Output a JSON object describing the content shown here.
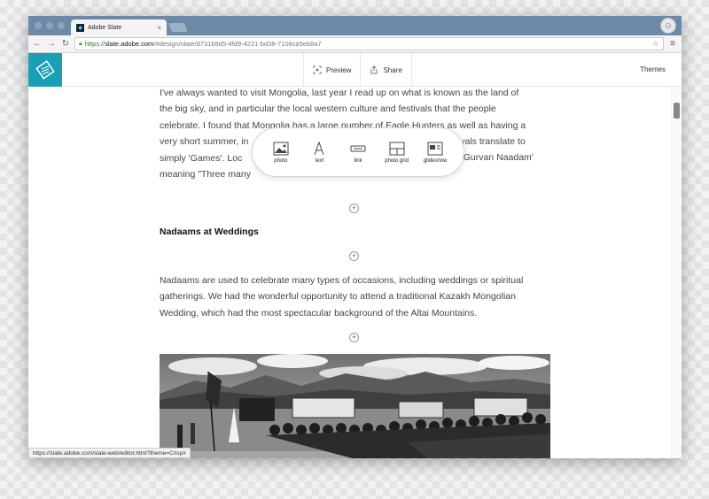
{
  "browser": {
    "tab_title": "Adobe Slate",
    "tab_close": "×",
    "url_scheme": "https://",
    "url_host": "slate.adobe.com",
    "url_path": "/#design/slate/d731b9d5-4fd9-4221-bd38-7106ca5eb8a7",
    "status_url": "https://slate.adobe.com/slate-web/editor.html?theme=Crisp#"
  },
  "app": {
    "preview_label": "Preview",
    "share_label": "Share",
    "themes_label": "Themes"
  },
  "content": {
    "intro_lines": [
      "I've always wanted to visit Mongolia, last year I read up on what is known as the land of",
      "the big sky, and in particular the local western culture and festivals that the people",
      "celebrate. I found that Mongolia has a large number of Eagle Hunters as well as having a",
      "very short summer, in",
      "simply 'Games'. Loc",
      "meaning \"Three many"
    ],
    "intro_right_fragments": [
      "tivals translate to",
      "n Gurvan Naadam'"
    ],
    "heading": "Nadaams at Weddings",
    "body_lines": [
      "Nadaams are used to celebrate many types of occasions, including weddings or spiritual",
      "gatherings. We had the wonderful opportunity to attend a traditional Kazakh Mongolian",
      "Wedding, which had the most spectacular background of the Altai Mountains."
    ]
  },
  "insert_menu": [
    {
      "label": "photo",
      "icon": "photo-icon"
    },
    {
      "label": "text",
      "icon": "text-icon"
    },
    {
      "label": "link",
      "icon": "link-icon"
    },
    {
      "label": "photo grid",
      "icon": "photo-grid-icon"
    },
    {
      "label": "glideshow",
      "icon": "glideshow-icon"
    }
  ],
  "colors": {
    "brand": "#1aa0b5",
    "tabbar": "#6c8aa8"
  }
}
